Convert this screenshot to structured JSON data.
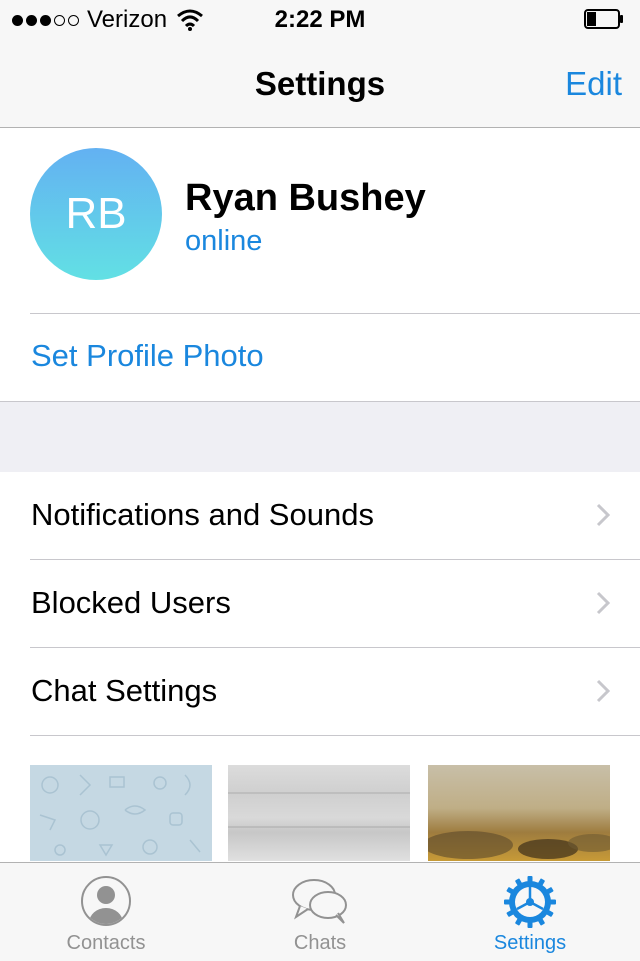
{
  "status_bar": {
    "carrier": "Verizon",
    "time": "2:22 PM",
    "signal_filled": 3,
    "signal_total": 5,
    "battery_fraction": 0.3
  },
  "nav": {
    "title": "Settings",
    "edit_label": "Edit"
  },
  "profile": {
    "initials": "RB",
    "name": "Ryan Bushey",
    "status": "online",
    "set_photo_label": "Set Profile Photo"
  },
  "menu": [
    {
      "label": "Notifications and Sounds"
    },
    {
      "label": "Blocked Users"
    },
    {
      "label": "Chat Settings"
    }
  ],
  "tabs": [
    {
      "label": "Contacts",
      "icon": "person-icon",
      "active": false
    },
    {
      "label": "Chats",
      "icon": "chat-bubbles-icon",
      "active": false
    },
    {
      "label": "Settings",
      "icon": "gear-icon",
      "active": true
    }
  ],
  "colors": {
    "accent": "#1a87de",
    "avatar_gradient_top": "#63b1f2",
    "avatar_gradient_bottom": "#62e0e4",
    "inactive_tab": "#929292"
  }
}
